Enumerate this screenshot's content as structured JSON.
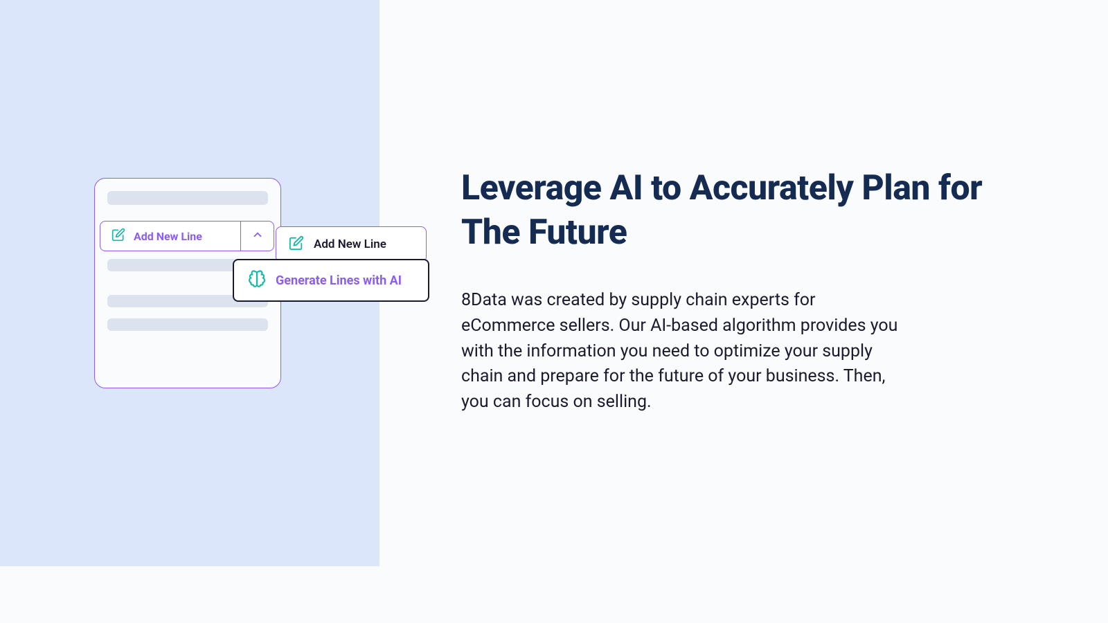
{
  "right": {
    "heading": "Leverage AI to Accurately Plan for The Future",
    "body": "8Data was created by supply chain experts for eCommerce sellers. Our AI-based algorithm provides you with the information you need to optimize your supply chain and prepare for the future of your business. Then, you can focus on selling."
  },
  "mockup": {
    "add_line_label": "Add New Line",
    "popup": {
      "item1_label": "Add New Line",
      "item2_label": "Generate Lines with AI"
    }
  }
}
